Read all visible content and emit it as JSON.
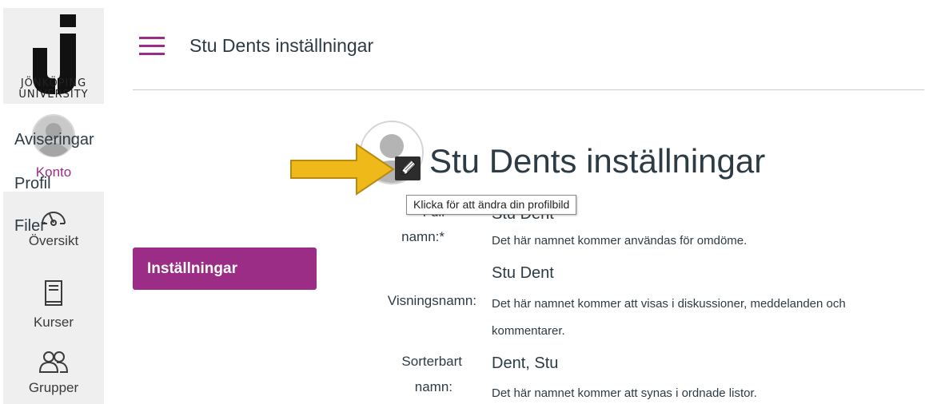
{
  "brand": {
    "logo_line1": "JÖNKÖPING",
    "logo_line2": "UNIVERSITY",
    "accent_color": "#9b2d86"
  },
  "global_nav": {
    "items": [
      {
        "label": "Konto",
        "icon": "avatar-icon",
        "active": true
      },
      {
        "label": "Översikt",
        "icon": "dashboard-gauge-icon",
        "active": false
      },
      {
        "label": "Kurser",
        "icon": "book-icon",
        "active": false
      },
      {
        "label": "Grupper",
        "icon": "people-icon",
        "active": false
      }
    ]
  },
  "header": {
    "title": "Stu Dents inställningar",
    "menu_icon": "hamburger-icon"
  },
  "section_nav": {
    "items": [
      {
        "label": "Aviseringar",
        "active": false
      },
      {
        "label": "Profil",
        "active": false
      },
      {
        "label": "Filer",
        "active": false
      },
      {
        "label": "Inställningar",
        "active": true
      }
    ]
  },
  "main": {
    "title": "Stu Dents inställningar",
    "avatar_icon": "profile-avatar-icon",
    "edit_icon": "pencil-icon",
    "tooltip": "Klicka för att ändra din profilbild",
    "fields": [
      {
        "label_line1": "Full",
        "label_line2": "namn:*",
        "value": "Stu Dent",
        "hint": "Det här namnet kommer användas för omdöme."
      },
      {
        "label_line1": "Visningsnamn:",
        "label_line2": "",
        "value": "Stu Dent",
        "hint_line1": "Det här namnet kommer att visas i diskussioner, meddelanden och",
        "hint_line2": "kommentarer."
      },
      {
        "label_line1": "Sorterbart",
        "label_line2": "namn:",
        "value": "Dent, Stu",
        "hint": "Det här namnet kommer att synas i ordnade listor."
      }
    ]
  }
}
